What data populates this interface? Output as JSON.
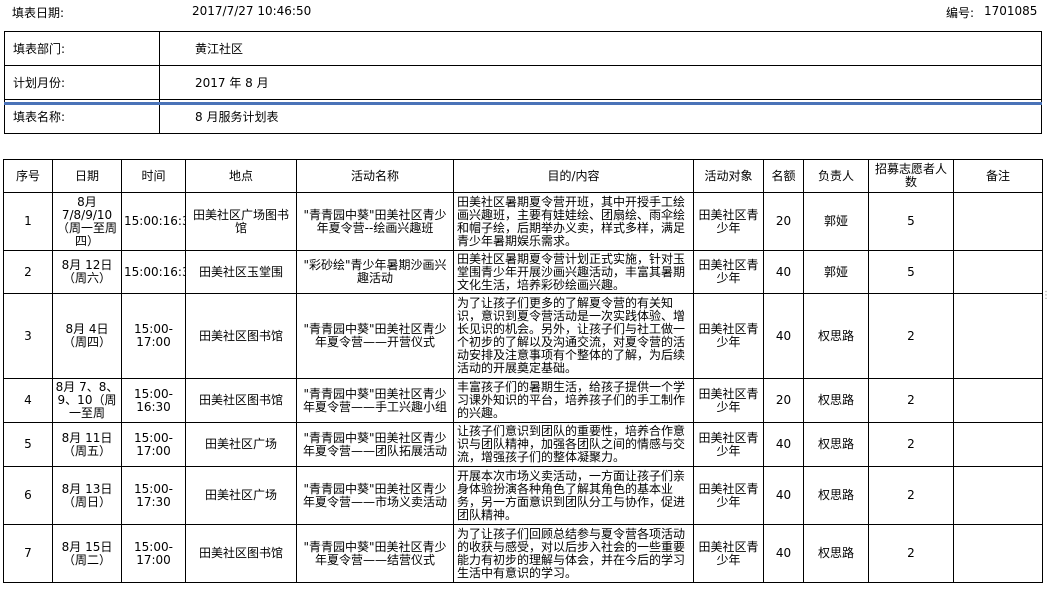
{
  "header": {
    "date_label": "填表日期:",
    "date_value": "2017/7/27 10:46:50",
    "number_label": "编号:",
    "number_value": "1701085"
  },
  "info": [
    {
      "label": "填表部门:",
      "value": "黄江社区"
    },
    {
      "label": "计划月份:",
      "value": "2017 年 8 月"
    },
    {
      "label": "填表名称:",
      "value": "8 月服务计划表"
    }
  ],
  "table": {
    "columns": [
      "序号",
      "日期",
      "时间",
      "地点",
      "活动名称",
      "目的/内容",
      "活动对象",
      "名额",
      "负责人",
      "招募志愿者人数",
      "备注"
    ],
    "rows": [
      {
        "no": "1",
        "date": "8月 7/8/9/10（周一至周四）",
        "time": "15:00:16:30",
        "place": "田美社区广场图书馆",
        "name": "\"青青园中葵\"田美社区青少年夏令营--绘画兴趣班",
        "content": "田美社区暑期夏令营开班，其中开授手工绘画兴趣班，主要有娃娃绘、团扇绘、雨伞绘和帽子绘，后期举办义卖，样式多样，满足青少年暑期娱乐需求。",
        "target": "田美社区青少年",
        "quota": "20",
        "leader": "郭娅",
        "volunteers": "5",
        "remark": ""
      },
      {
        "no": "2",
        "date": "8月 12日（周六）",
        "time": "15:00:16:30",
        "place": "田美社区玉堂围",
        "name": "\"彩砂绘\"青少年暑期沙画兴趣活动",
        "content": "田美社区暑期夏令营计划正式实施，针对玉堂围青少年开展沙画兴趣活动，丰富其暑期文化生活，培养彩砂绘画兴趣。",
        "target": "田美社区青少年",
        "quota": "40",
        "leader": "郭娅",
        "volunteers": "5",
        "remark": ""
      },
      {
        "no": "3",
        "date": "8月 4日（周四）",
        "time": "15:00-17:00",
        "place": "田美社区图书馆",
        "name": "\"青青园中葵\"田美社区青少年夏令营——开营仪式",
        "content": "为了让孩子们更多的了解夏令营的有关知识，意识到夏令营活动是一次实践体验、增长见识的机会。另外，让孩子们与社工做一个初步的了解以及沟通交流，对夏令营的活动安排及注意事项有个整体的了解，为后续活动的开展奠定基础。",
        "target": "田美社区青少年",
        "quota": "40",
        "leader": "权思路",
        "volunteers": "2",
        "remark": ""
      },
      {
        "no": "4",
        "date": "8月 7、8、9、10（周一至周",
        "time": "15:00-16:30",
        "place": "田美社区图书馆",
        "name": "\"青青园中葵\"田美社区青少年夏令营——手工兴趣小组",
        "content": "丰富孩子们的暑期生活，给孩子提供一个学习课外知识的平台，培养孩子们的手工制作的兴趣。",
        "target": "田美社区青少年",
        "quota": "20",
        "leader": "权思路",
        "volunteers": "2",
        "remark": ""
      },
      {
        "no": "5",
        "date": "8月 11日（周五）",
        "time": "15:00-17:00",
        "place": "田美社区广场",
        "name": "\"青青园中葵\"田美社区青少年夏令营——团队拓展活动",
        "content": "让孩子们意识到团队的重要性，培养合作意识与团队精神，加强各团队之间的情感与交流，增强孩子们的整体凝聚力。",
        "target": "田美社区青少年",
        "quota": "40",
        "leader": "权思路",
        "volunteers": "2",
        "remark": ""
      },
      {
        "no": "6",
        "date": "8月 13日（周日）",
        "time": "15:00-17:30",
        "place": "田美社区广场",
        "name": "\"青青园中葵\"田美社区青少年夏令营——市场义卖活动",
        "content": "开展本次市场义卖活动，一方面让孩子们亲身体验扮演各种角色了解其角色的基本业务，另一方面意识到团队分工与协作，促进团队精神。",
        "target": "田美社区青少年",
        "quota": "40",
        "leader": "权思路",
        "volunteers": "2",
        "remark": ""
      },
      {
        "no": "7",
        "date": "8月 15日（周二）",
        "time": "15:00-17:00",
        "place": "田美社区图书馆",
        "name": "\"青青园中葵\"田美社区青少年夏令营——结营仪式",
        "content": "为了让孩子们回顾总结参与夏令营各项活动的收获与感受，对以后步入社会的一些重要能力有初步的理解与体会，并在今后的学习生活中有意识的学习。",
        "target": "田美社区青少年",
        "quota": "40",
        "leader": "权思路",
        "volunteers": "2",
        "remark": ""
      }
    ]
  }
}
